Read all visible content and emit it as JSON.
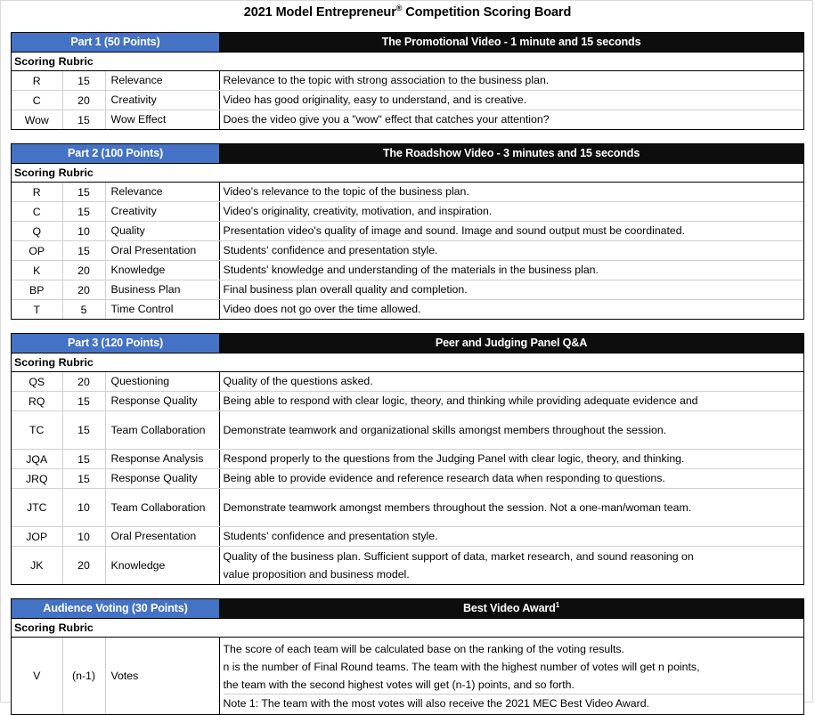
{
  "document": {
    "title_prefix": "2021 Model Entrepreneur",
    "title_mark": "®",
    "title_suffix": " Competition Scoring Board",
    "rubric_label": "Scoring Rubric",
    "accent_blue": "#4472C4",
    "header_black": "#0D0D0D"
  },
  "sections": [
    {
      "part_label": "Part 1 (50 Points)",
      "part_desc": "The Promotional Video - 1 minute and 15 seconds",
      "rubric_label": "Scoring Rubric",
      "items": [
        {
          "code": "R",
          "points": "15",
          "name": "Relevance",
          "desc": "Relevance to the topic with strong association to the business plan."
        },
        {
          "code": "C",
          "points": "20",
          "name": "Creativity",
          "desc": "Video has good originality, easy to understand, and is creative."
        },
        {
          "code": "Wow",
          "points": "15",
          "name": "Wow Effect",
          "desc": "Does the video give you a \"wow\" effect that catches your attention?"
        }
      ]
    },
    {
      "part_label": "Part 2 (100 Points)",
      "part_desc": "The Roadshow Video - 3 minutes and 15 seconds",
      "rubric_label": "Scoring Rubric",
      "items": [
        {
          "code": "R",
          "points": "15",
          "name": "Relevance",
          "desc": "Video's relevance to the topic of the business plan."
        },
        {
          "code": "C",
          "points": "15",
          "name": "Creativity",
          "desc": "Video's originality, creativity, motivation, and inspiration."
        },
        {
          "code": "Q",
          "points": "10",
          "name": "Quality",
          "desc": "Presentation video's quality of image and sound. Image and sound output must be coordinated."
        },
        {
          "code": "OP",
          "points": "15",
          "name": "Oral Presentation",
          "desc": "Students' confidence and presentation style."
        },
        {
          "code": "K",
          "points": "20",
          "name": "Knowledge",
          "desc": "Students' knowledge and understanding of the materials in the business plan."
        },
        {
          "code": "BP",
          "points": "20",
          "name": "Business Plan",
          "desc": "Final business plan overall quality and completion."
        },
        {
          "code": "T",
          "points": "5",
          "name": "Time Control",
          "desc": "Video does not go over the time allowed."
        }
      ]
    },
    {
      "part_label": "Part 3 (120 Points)",
      "part_desc": "Peer and Judging Panel Q&A",
      "rubric_label": "Scoring Rubric",
      "items": [
        {
          "code": "QS",
          "points": "20",
          "name": "Questioning",
          "desc": "Quality of the questions asked."
        },
        {
          "code": "RQ",
          "points": "15",
          "name": "Response Quality",
          "desc": "Being able to respond with clear logic, theory, and thinking while providing adequate evidence and"
        },
        {
          "code": "TC",
          "points": "15",
          "name": "Team Collaboration",
          "desc": "Demonstrate teamwork and organizational skills amongst members throughout the session."
        },
        {
          "code": "JQA",
          "points": "15",
          "name": "Response Analysis",
          "desc": "Respond properly to the questions from the Judging Panel with clear logic, theory, and thinking."
        },
        {
          "code": "JRQ",
          "points": "15",
          "name": "Response Quality",
          "desc": "Being able to provide evidence and reference research data when responding to questions."
        },
        {
          "code": "JTC",
          "points": "10",
          "name": "Team Collaboration",
          "desc": "Demonstrate teamwork amongst members throughout the session. Not a one-man/woman team."
        },
        {
          "code": "JOP",
          "points": "10",
          "name": "Oral Presentation",
          "desc": "Students' confidence and presentation style."
        },
        {
          "code": "JK",
          "points": "20",
          "name": "Knowledge",
          "desc_line_1": "Quality of the business plan. Sufficient support of data, market research, and sound reasoning on",
          "desc_line_2": "value proposition and business model."
        }
      ]
    },
    {
      "part_label": "Audience Voting (30 Points)",
      "part_desc": "Best Video Award",
      "part_desc_footnote": "1",
      "rubric_label": "Scoring Rubric",
      "items": [
        {
          "code": "V",
          "points": "(n-1)",
          "name": "Votes",
          "desc_line_1": "The score of each team will be calculated base on the ranking of the voting results.",
          "desc_line_2": "n is the number of Final Round teams. The team with the highest number of votes will get n points,",
          "desc_line_3": "the team with the second highest votes will get (n-1) points, and so forth.",
          "desc_line_4": "Note 1: The team with the most votes will also receive the 2021 MEC Best Video Award."
        }
      ]
    }
  ]
}
